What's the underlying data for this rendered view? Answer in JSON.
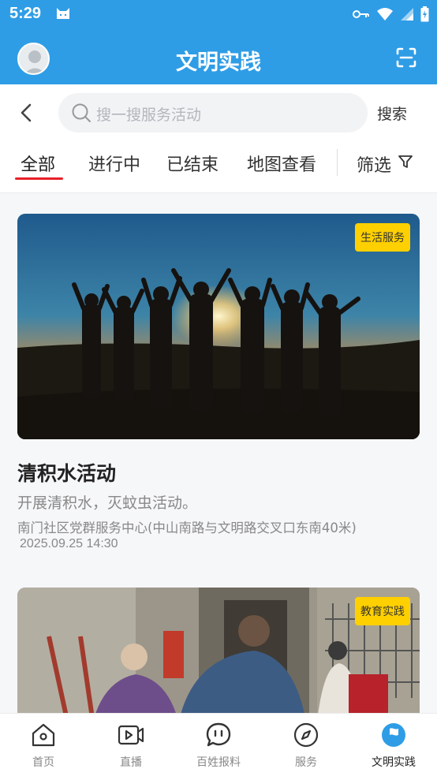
{
  "status_bar": {
    "time": "5:29"
  },
  "header": {
    "title": "文明实践",
    "avatar_icon": "user-avatar",
    "scan_icon": "scan-icon"
  },
  "search": {
    "placeholder": "搜一搜服务活动",
    "button_label": "搜索"
  },
  "tabs": [
    {
      "label": "全部",
      "active": true
    },
    {
      "label": "进行中",
      "active": false
    },
    {
      "label": "已结束",
      "active": false
    },
    {
      "label": "地图查看",
      "active": false
    }
  ],
  "filter": {
    "label": "筛选"
  },
  "cards": [
    {
      "badge": "生活服务",
      "title": "清积水活动",
      "description": "开展清积水，灭蚊虫活动。",
      "location": "南门社区党群服务中心(中山南路与文明路交叉口东南40米)",
      "date": "2025.09.25 14:30"
    },
    {
      "badge": "教育实践"
    }
  ],
  "bottom_nav": [
    {
      "label": "首页",
      "icon": "home-icon",
      "active": false
    },
    {
      "label": "直播",
      "icon": "video-icon",
      "active": false
    },
    {
      "label": "百姓报料",
      "icon": "chat-icon",
      "active": false
    },
    {
      "label": "服务",
      "icon": "compass-icon",
      "active": false
    },
    {
      "label": "文明实践",
      "icon": "flag-icon",
      "active": true
    }
  ],
  "colors": {
    "primary": "#2f9de6",
    "tab_underline": "#e8202a",
    "badge": "#ffd000"
  }
}
